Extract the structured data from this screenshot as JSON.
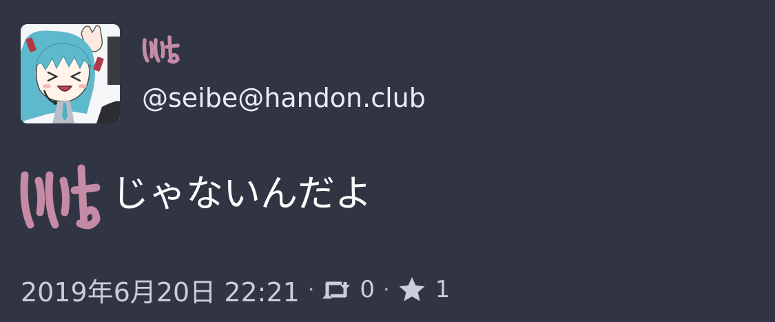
{
  "status": {
    "account": {
      "emoji_name": "いいよ",
      "handle": "@seibe@handon.club"
    },
    "content": {
      "emoji_name": "いいよ",
      "text": "じゃないんだよ"
    },
    "meta": {
      "timestamp": "2019年6月20日 22:21",
      "separator": "·",
      "boosts": "0",
      "favourites": "1"
    },
    "icons": {
      "boost": "retweet-icon",
      "favourite": "star-icon"
    },
    "colors": {
      "background": "#313543",
      "emoji": "#c58aa6",
      "text": "#ffffff",
      "meta": "#c9cede"
    }
  }
}
